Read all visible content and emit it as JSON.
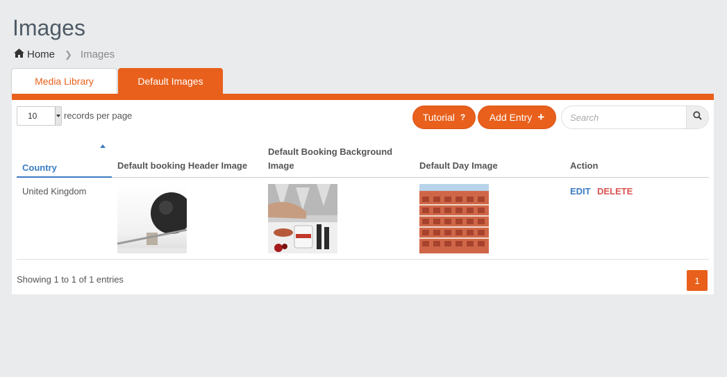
{
  "page": {
    "title": "Images"
  },
  "breadcrumb": {
    "home": "Home",
    "current": "Images"
  },
  "tabs": [
    {
      "label": "Media Library",
      "active": true
    },
    {
      "label": "Default Images",
      "active": false
    }
  ],
  "toolbar": {
    "records_per_page": "10",
    "records_label": "records per page",
    "tutorial_label": "Tutorial",
    "add_entry_label": "Add Entry",
    "search_placeholder": "Search"
  },
  "table": {
    "columns": [
      "Country",
      "Default booking Header Image",
      "Default Booking Background Image",
      "Default Day Image",
      "Action"
    ],
    "sorted_column": "Country",
    "rows": [
      {
        "country": "United Kingdom",
        "edit": "EDIT",
        "delete": "DELETE"
      }
    ]
  },
  "footer": {
    "info": "Showing 1 to 1 of 1 entries",
    "current_page": "1"
  },
  "colors": {
    "accent": "#e8601c",
    "link": "#3a7bc1",
    "danger": "#d9534f",
    "background": "#e9ebec"
  },
  "icons": {
    "home": "home-icon",
    "chevron": "chevron-right-icon",
    "search": "search-icon",
    "help": "question-icon",
    "add": "plus-icon",
    "sort": "sort-asc-icon"
  }
}
